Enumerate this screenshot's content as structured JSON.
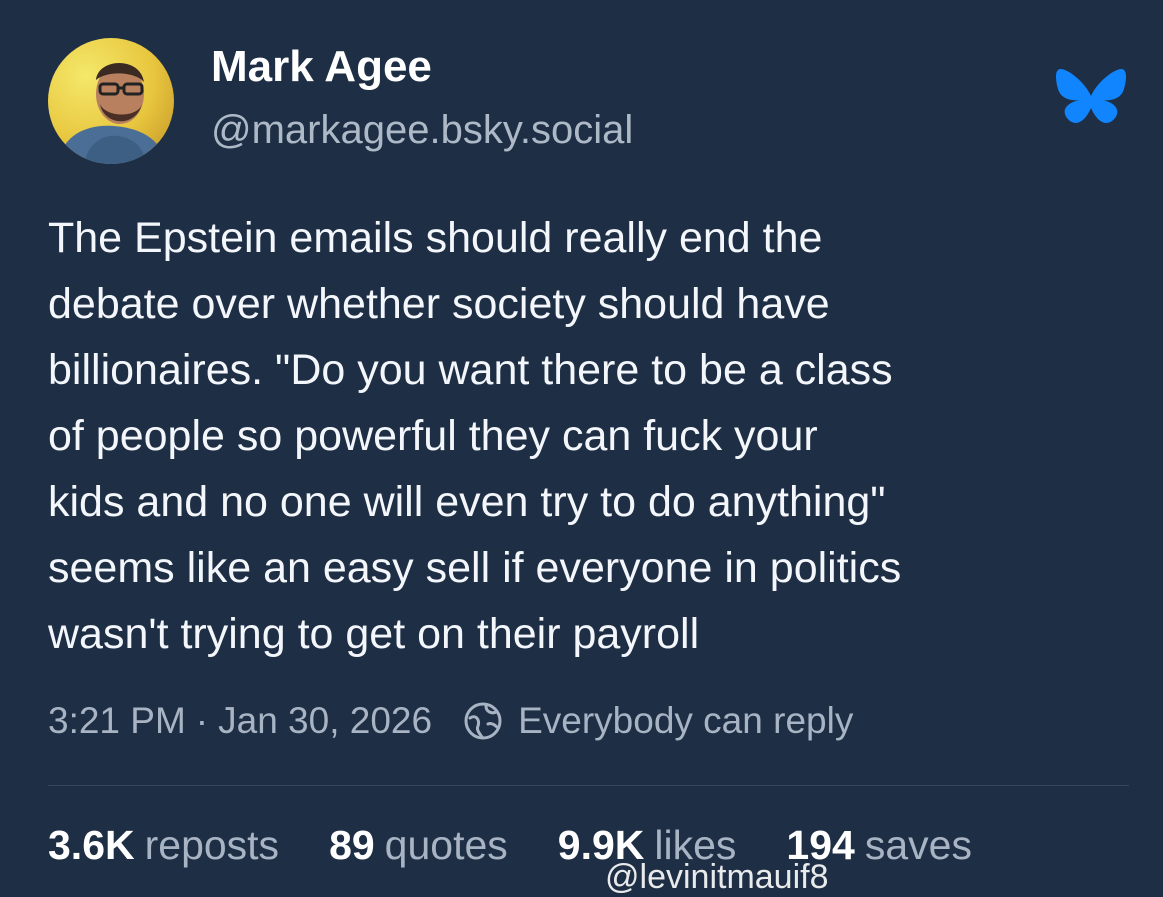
{
  "author": {
    "name": "Mark Agee",
    "handle": "@markagee.bsky.social"
  },
  "post": {
    "text_lines": [
      "The Epstein emails should really end the",
      "debate over whether society should have",
      "billionaires. \"Do you want there to be a class",
      "of people so powerful they can fuck your",
      "kids and no one will even try to do anything\"",
      "seems like an easy sell if everyone in politics",
      "wasn't trying to get on their payroll"
    ],
    "time": "3:21 PM",
    "separator": "·",
    "date": "Jan 30, 2026",
    "reply_setting": "Everybody can reply"
  },
  "stats": [
    {
      "value": "3.6K",
      "label": "reposts"
    },
    {
      "value": "89",
      "label": "quotes"
    },
    {
      "value": "9.9K",
      "label": "likes"
    },
    {
      "value": "194",
      "label": "saves"
    }
  ],
  "watermark": "@levinitmauif8",
  "icons": {
    "logo": "bluesky-butterfly-icon",
    "reply": "globe-icon"
  },
  "colors": {
    "background": "#1e2e44",
    "brand": "#1185fe",
    "muted_text": "#a8b4c4"
  }
}
